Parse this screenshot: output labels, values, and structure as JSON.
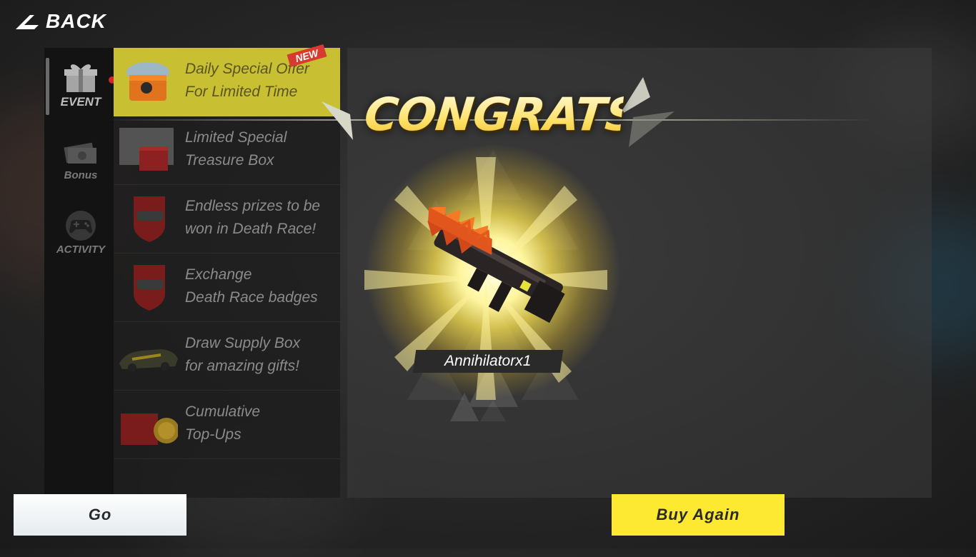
{
  "header": {
    "back_label": "BACK"
  },
  "sidebar": {
    "tabs": [
      {
        "label": "EVENT",
        "icon": "gift-icon",
        "active": true,
        "has_dot": true
      },
      {
        "label": "Bonus",
        "icon": "cash-icon",
        "active": false
      },
      {
        "label": "ACTIVITY",
        "icon": "gamepad-icon",
        "active": false
      }
    ]
  },
  "events": [
    {
      "line1": "Daily Special Offer",
      "line2": "For Limited Time",
      "badge": "NEW",
      "active": true
    },
    {
      "line1": "Limited Special",
      "line2": "Treasure Box"
    },
    {
      "line1": "Endless prizes to be",
      "line2": "won in Death Race!"
    },
    {
      "line1": "Exchange",
      "line2": "Death Race badges"
    },
    {
      "line1": "Draw Supply Box",
      "line2": "for amazing gifts!"
    },
    {
      "line1": "Cumulative",
      "line2": "Top-Ups"
    }
  ],
  "reward": {
    "title": "CONGRATS!",
    "item_name": "Annihilatorx1",
    "icon": "rifle-icon"
  },
  "buttons": {
    "go": "Go",
    "buy_again": "Buy Again"
  },
  "colors": {
    "accent_yellow": "#fde932",
    "active_item": "#c8c032",
    "badge_red": "#d73a2f"
  }
}
